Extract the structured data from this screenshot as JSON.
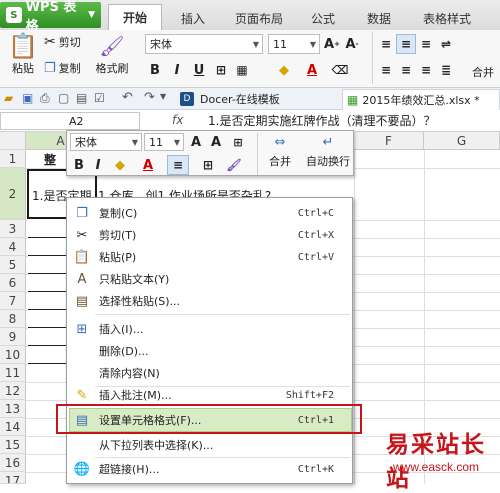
{
  "app": {
    "title": "WPS 表格"
  },
  "tabs": [
    "开始",
    "插入",
    "页面布局",
    "公式",
    "数据",
    "表格样式"
  ],
  "ribbon": {
    "paste": "粘贴",
    "cut": "剪切",
    "copy": "复制",
    "format_painter": "格式刷",
    "font_name": "宋体",
    "font_size": "11",
    "merge_partial": "合并"
  },
  "quickbar": {
    "docer_tab": "Docer-在线模板",
    "file_tab": "2015年绩效汇总.xlsx *"
  },
  "formula_bar": {
    "name_box": "A2",
    "fx": "fx",
    "content": "1.是否定期实施红牌作战（清理不要品）？"
  },
  "grid": {
    "columns": [
      "A",
      "E",
      "F",
      "G"
    ],
    "rows": [
      "1",
      "2",
      "3",
      "4",
      "5",
      "6",
      "7",
      "8",
      "9",
      "10",
      "11",
      "12",
      "13",
      "14",
      "15",
      "16",
      "17"
    ],
    "cell_a1": "整",
    "cell_a2": "1.是否定期",
    "cell_b2": "1.仓库、创1.作业场所是否杂乱?"
  },
  "mini_toolbar": {
    "font_name": "宋体",
    "font_size": "11",
    "merge": "合并",
    "wrap": "自动换行"
  },
  "context_menu": {
    "items": [
      {
        "label": "复制(C)",
        "shortcut": "Ctrl+C",
        "icon": "copy-icon"
      },
      {
        "label": "剪切(T)",
        "shortcut": "Ctrl+X",
        "icon": "scissors-icon"
      },
      {
        "label": "粘贴(P)",
        "shortcut": "Ctrl+V",
        "icon": "paste-icon"
      },
      {
        "label": "只粘贴文本(Y)",
        "shortcut": "",
        "icon": "paste-text-icon"
      },
      {
        "label": "选择性粘贴(S)...",
        "shortcut": "",
        "icon": "paste-special-icon"
      },
      {
        "label": "插入(I)...",
        "shortcut": "",
        "icon": "insert-icon"
      },
      {
        "label": "删除(D)...",
        "shortcut": "",
        "icon": ""
      },
      {
        "label": "清除内容(N)",
        "shortcut": "",
        "icon": ""
      },
      {
        "label": "插入批注(M)...",
        "shortcut": "Shift+F2",
        "icon": "comment-icon"
      },
      {
        "label": "设置单元格格式(F)...",
        "shortcut": "Ctrl+1",
        "icon": "format-cells-icon"
      },
      {
        "label": "从下拉列表中选择(K)...",
        "shortcut": "",
        "icon": ""
      },
      {
        "label": "超链接(H)...",
        "shortcut": "Ctrl+K",
        "icon": "hyperlink-icon"
      }
    ]
  },
  "watermark": {
    "text": "易采站长站",
    "url": "www.easck.com"
  },
  "colors": {
    "wps_green": "#3a9b2c",
    "highlight": "#d8ebc4",
    "annotation_red": "#c7141a"
  }
}
